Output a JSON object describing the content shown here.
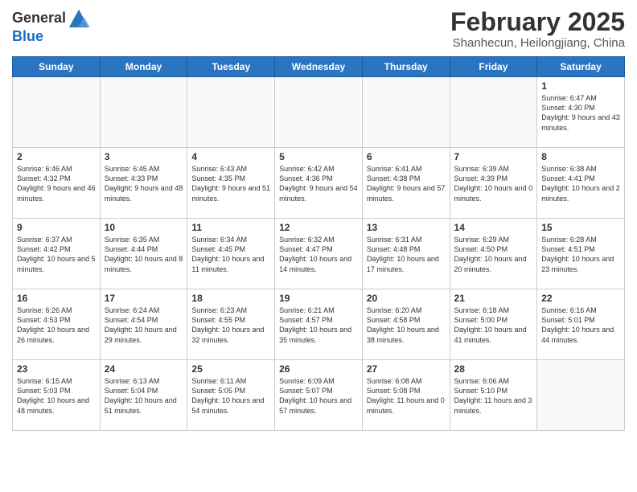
{
  "header": {
    "logo_general": "General",
    "logo_blue": "Blue",
    "title": "February 2025",
    "subtitle": "Shanhecun, Heilongjiang, China"
  },
  "days_of_week": [
    "Sunday",
    "Monday",
    "Tuesday",
    "Wednesday",
    "Thursday",
    "Friday",
    "Saturday"
  ],
  "weeks": [
    [
      {
        "day": "",
        "info": ""
      },
      {
        "day": "",
        "info": ""
      },
      {
        "day": "",
        "info": ""
      },
      {
        "day": "",
        "info": ""
      },
      {
        "day": "",
        "info": ""
      },
      {
        "day": "",
        "info": ""
      },
      {
        "day": "1",
        "info": "Sunrise: 6:47 AM\nSunset: 4:30 PM\nDaylight: 9 hours and 43 minutes."
      }
    ],
    [
      {
        "day": "2",
        "info": "Sunrise: 6:46 AM\nSunset: 4:32 PM\nDaylight: 9 hours and 46 minutes."
      },
      {
        "day": "3",
        "info": "Sunrise: 6:45 AM\nSunset: 4:33 PM\nDaylight: 9 hours and 48 minutes."
      },
      {
        "day": "4",
        "info": "Sunrise: 6:43 AM\nSunset: 4:35 PM\nDaylight: 9 hours and 51 minutes."
      },
      {
        "day": "5",
        "info": "Sunrise: 6:42 AM\nSunset: 4:36 PM\nDaylight: 9 hours and 54 minutes."
      },
      {
        "day": "6",
        "info": "Sunrise: 6:41 AM\nSunset: 4:38 PM\nDaylight: 9 hours and 57 minutes."
      },
      {
        "day": "7",
        "info": "Sunrise: 6:39 AM\nSunset: 4:39 PM\nDaylight: 10 hours and 0 minutes."
      },
      {
        "day": "8",
        "info": "Sunrise: 6:38 AM\nSunset: 4:41 PM\nDaylight: 10 hours and 2 minutes."
      }
    ],
    [
      {
        "day": "9",
        "info": "Sunrise: 6:37 AM\nSunset: 4:42 PM\nDaylight: 10 hours and 5 minutes."
      },
      {
        "day": "10",
        "info": "Sunrise: 6:35 AM\nSunset: 4:44 PM\nDaylight: 10 hours and 8 minutes."
      },
      {
        "day": "11",
        "info": "Sunrise: 6:34 AM\nSunset: 4:45 PM\nDaylight: 10 hours and 11 minutes."
      },
      {
        "day": "12",
        "info": "Sunrise: 6:32 AM\nSunset: 4:47 PM\nDaylight: 10 hours and 14 minutes."
      },
      {
        "day": "13",
        "info": "Sunrise: 6:31 AM\nSunset: 4:48 PM\nDaylight: 10 hours and 17 minutes."
      },
      {
        "day": "14",
        "info": "Sunrise: 6:29 AM\nSunset: 4:50 PM\nDaylight: 10 hours and 20 minutes."
      },
      {
        "day": "15",
        "info": "Sunrise: 6:28 AM\nSunset: 4:51 PM\nDaylight: 10 hours and 23 minutes."
      }
    ],
    [
      {
        "day": "16",
        "info": "Sunrise: 6:26 AM\nSunset: 4:53 PM\nDaylight: 10 hours and 26 minutes."
      },
      {
        "day": "17",
        "info": "Sunrise: 6:24 AM\nSunset: 4:54 PM\nDaylight: 10 hours and 29 minutes."
      },
      {
        "day": "18",
        "info": "Sunrise: 6:23 AM\nSunset: 4:55 PM\nDaylight: 10 hours and 32 minutes."
      },
      {
        "day": "19",
        "info": "Sunrise: 6:21 AM\nSunset: 4:57 PM\nDaylight: 10 hours and 35 minutes."
      },
      {
        "day": "20",
        "info": "Sunrise: 6:20 AM\nSunset: 4:58 PM\nDaylight: 10 hours and 38 minutes."
      },
      {
        "day": "21",
        "info": "Sunrise: 6:18 AM\nSunset: 5:00 PM\nDaylight: 10 hours and 41 minutes."
      },
      {
        "day": "22",
        "info": "Sunrise: 6:16 AM\nSunset: 5:01 PM\nDaylight: 10 hours and 44 minutes."
      }
    ],
    [
      {
        "day": "23",
        "info": "Sunrise: 6:15 AM\nSunset: 5:03 PM\nDaylight: 10 hours and 48 minutes."
      },
      {
        "day": "24",
        "info": "Sunrise: 6:13 AM\nSunset: 5:04 PM\nDaylight: 10 hours and 51 minutes."
      },
      {
        "day": "25",
        "info": "Sunrise: 6:11 AM\nSunset: 5:05 PM\nDaylight: 10 hours and 54 minutes."
      },
      {
        "day": "26",
        "info": "Sunrise: 6:09 AM\nSunset: 5:07 PM\nDaylight: 10 hours and 57 minutes."
      },
      {
        "day": "27",
        "info": "Sunrise: 6:08 AM\nSunset: 5:08 PM\nDaylight: 11 hours and 0 minutes."
      },
      {
        "day": "28",
        "info": "Sunrise: 6:06 AM\nSunset: 5:10 PM\nDaylight: 11 hours and 3 minutes."
      },
      {
        "day": "",
        "info": ""
      }
    ]
  ]
}
